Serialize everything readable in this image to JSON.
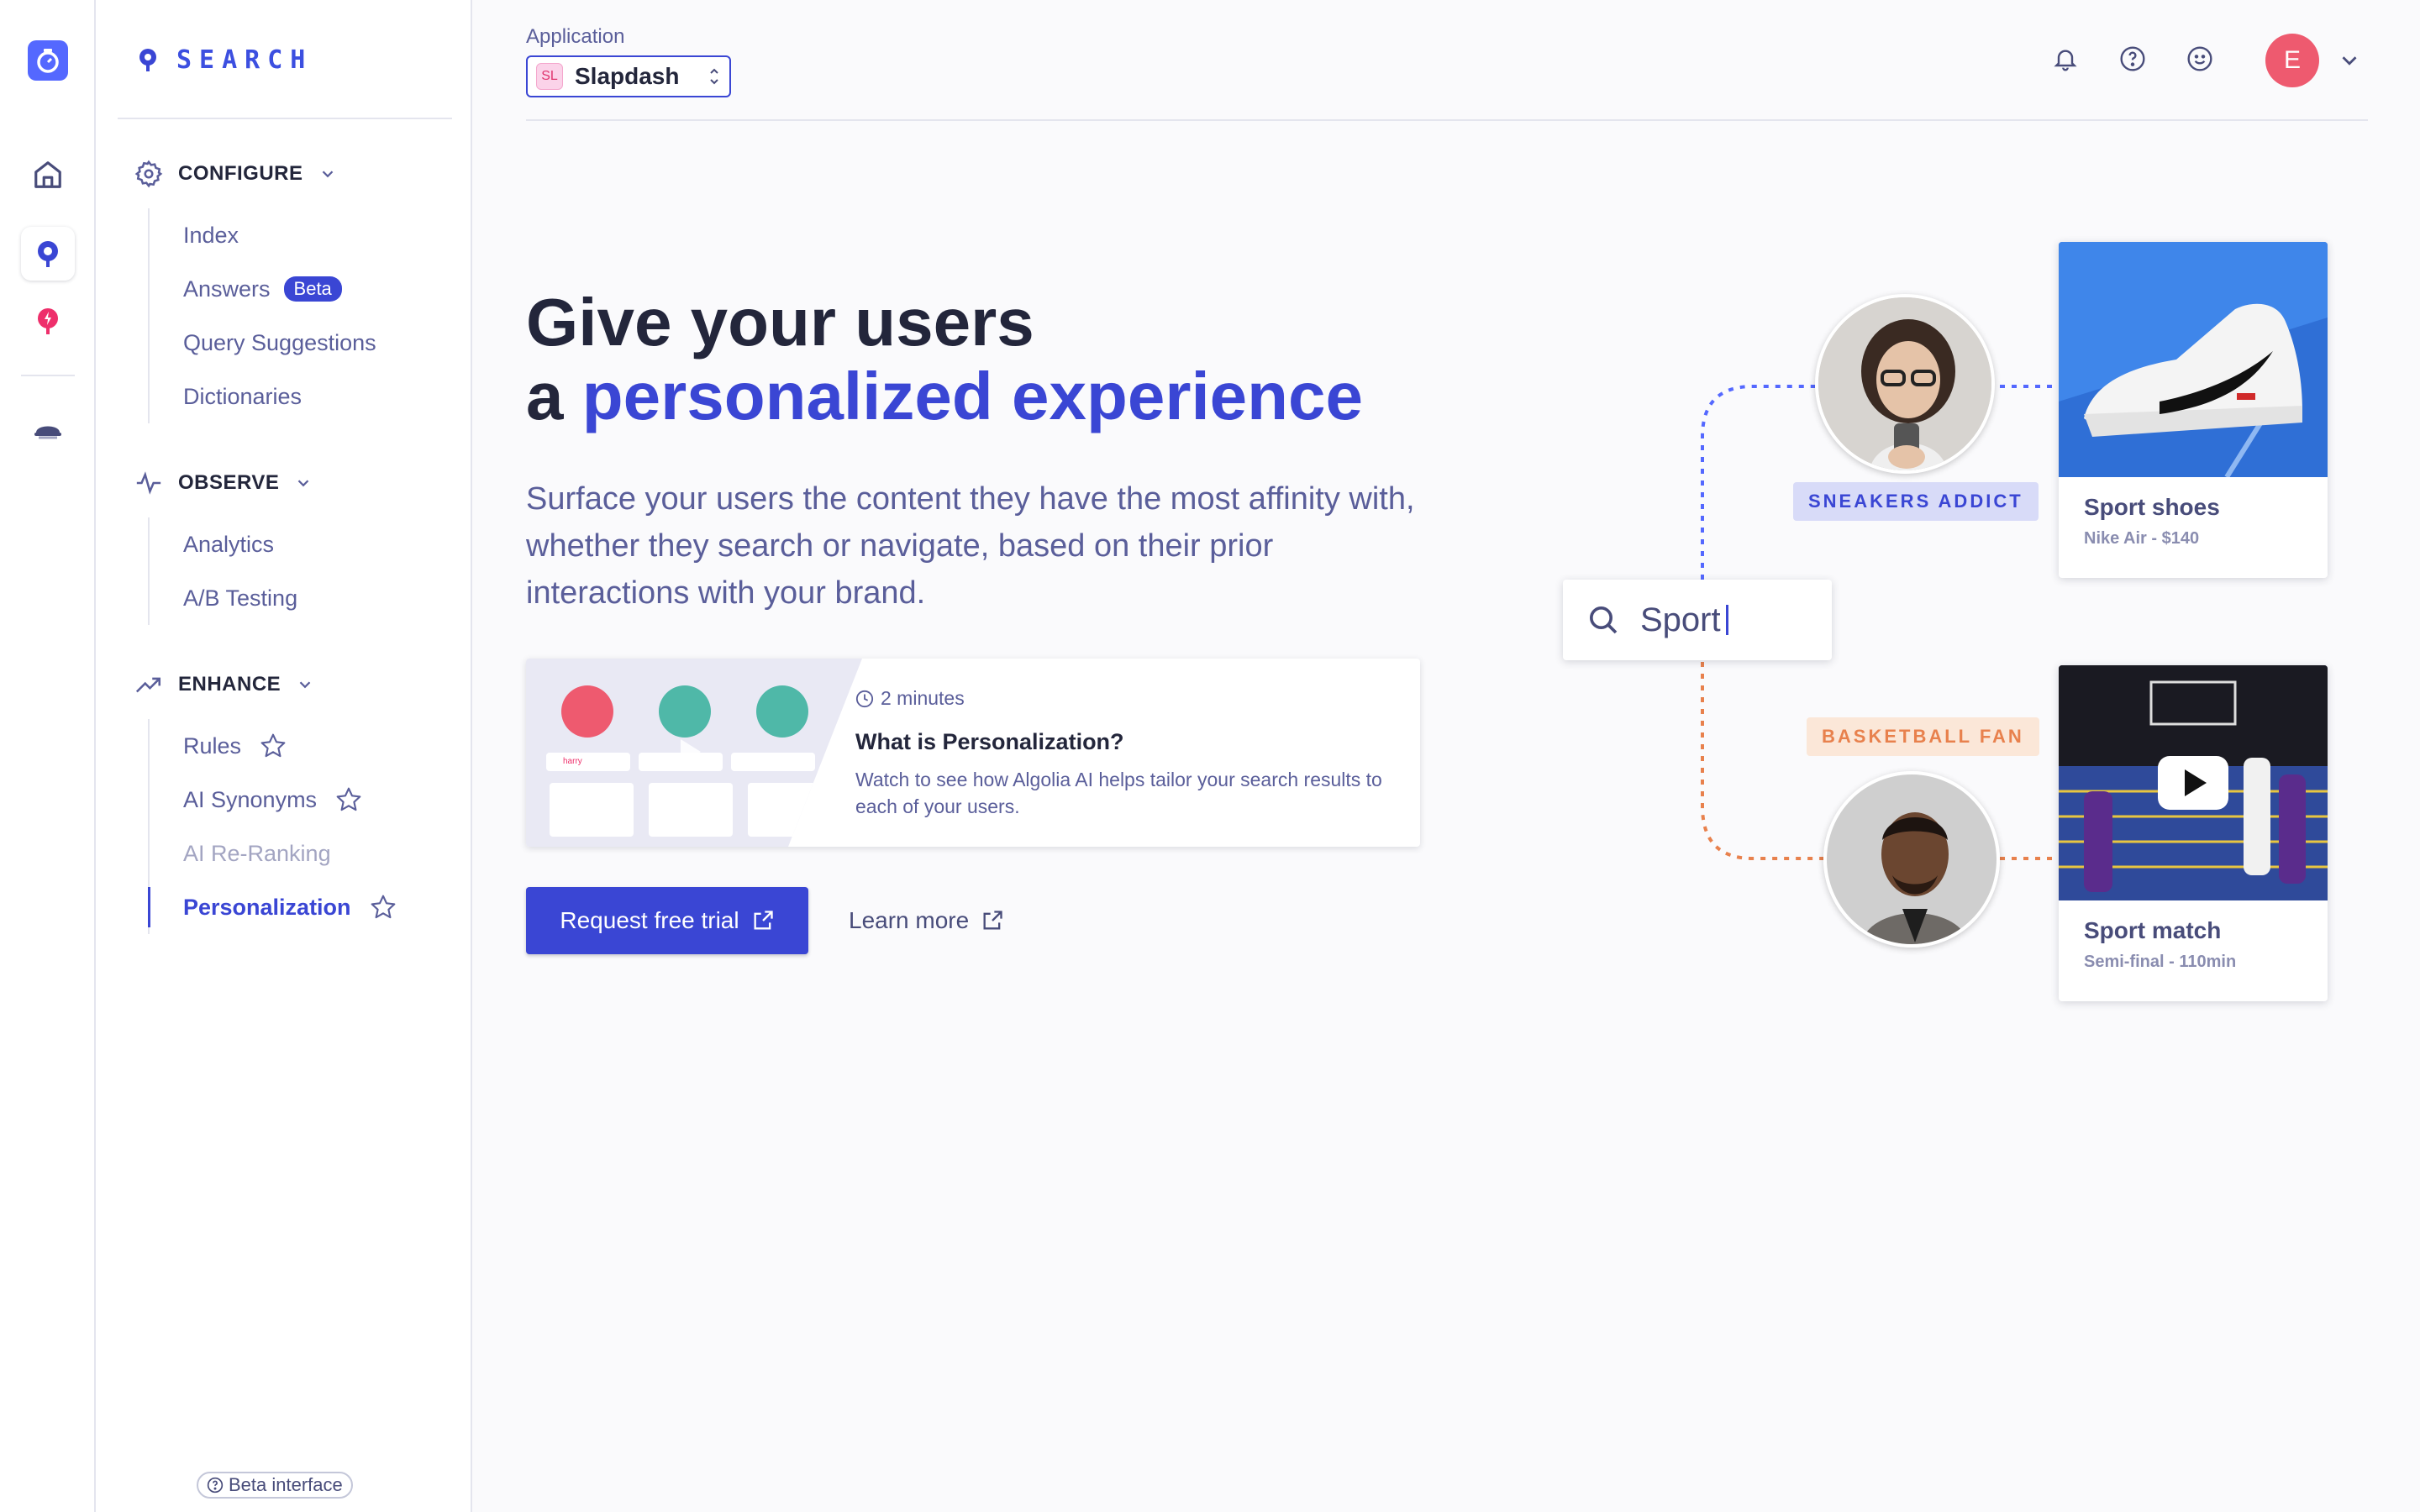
{
  "rail": {
    "items": [
      "home-icon",
      "search-product-icon",
      "recommend-icon",
      "crawler-icon"
    ]
  },
  "sidebar": {
    "brand": "SEARCH",
    "configure": {
      "title": "CONFIGURE",
      "items": [
        {
          "label": "Index"
        },
        {
          "label": "Answers",
          "badge": "Beta"
        },
        {
          "label": "Query Suggestions"
        },
        {
          "label": "Dictionaries"
        }
      ]
    },
    "observe": {
      "title": "OBSERVE",
      "items": [
        {
          "label": "Analytics"
        },
        {
          "label": "A/B Testing"
        }
      ]
    },
    "enhance": {
      "title": "ENHANCE",
      "items": [
        {
          "label": "Rules"
        },
        {
          "label": "AI Synonyms"
        },
        {
          "label": "AI Re-Ranking"
        },
        {
          "label": "Personalization"
        }
      ]
    },
    "footer": "Beta interface"
  },
  "header": {
    "app_label": "Application",
    "app_badge": "SL",
    "app_name": "Slapdash",
    "avatar_initial": "E"
  },
  "hero": {
    "title_line1": "Give your users",
    "title_line2_prefix": "a ",
    "title_line2_accent": "personalized experience",
    "description": "Surface your users the content they have the most affinity with, whether they search or navigate, based on their prior interactions with your brand.",
    "video": {
      "duration": "2 minutes",
      "title": "What is Personalization?",
      "description": "Watch to see how Algolia AI helps tailor your search results to each of your users.",
      "thumb_query": "harry"
    },
    "primary_button": "Request free trial",
    "secondary_link": "Learn more"
  },
  "illustration": {
    "search_text": "Sport",
    "persona1_tag": "SNEAKERS ADDICT",
    "persona2_tag": "BASKETBALL FAN",
    "product1": {
      "name": "Sport shoes",
      "sub": "Nike Air - $140"
    },
    "product2": {
      "name": "Sport match",
      "sub": "Semi-final - 110min"
    }
  },
  "colors": {
    "accent": "#3a46d4",
    "brand": "#5468ff",
    "persona_blue": "#5468ff",
    "persona_orange": "#e8814d",
    "avatar": "#ee5a6f"
  }
}
